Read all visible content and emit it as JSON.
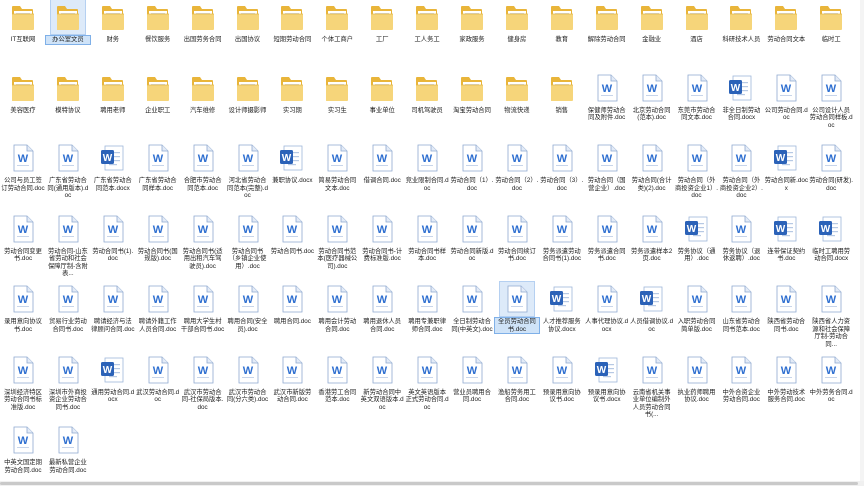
{
  "items": [
    {
      "label": "IT互联网",
      "icon": "folder-icon"
    },
    {
      "label": "办公室文员",
      "icon": "folder-icon",
      "selected": true
    },
    {
      "label": "财务",
      "icon": "folder-icon"
    },
    {
      "label": "餐饮服务",
      "icon": "folder-icon"
    },
    {
      "label": "出国劳务合同",
      "icon": "folder-icon"
    },
    {
      "label": "出国协议",
      "icon": "folder-icon"
    },
    {
      "label": "短期劳动合同",
      "icon": "folder-icon"
    },
    {
      "label": "个体工商户",
      "icon": "folder-icon"
    },
    {
      "label": "工厂",
      "icon": "folder-icon"
    },
    {
      "label": "工人务工",
      "icon": "folder-icon"
    },
    {
      "label": "家政服务",
      "icon": "folder-icon"
    },
    {
      "label": "健身房",
      "icon": "folder-icon"
    },
    {
      "label": "教育",
      "icon": "folder-icon"
    },
    {
      "label": "解除劳动合同",
      "icon": "folder-icon"
    },
    {
      "label": "金融业",
      "icon": "folder-icon"
    },
    {
      "label": "酒店",
      "icon": "folder-icon"
    },
    {
      "label": "科研技术人员",
      "icon": "folder-icon"
    },
    {
      "label": "劳动合同文本",
      "icon": "folder-icon"
    },
    {
      "label": "临时工",
      "icon": "folder-icon"
    },
    {
      "label": "美容医疗",
      "icon": "folder-icon"
    },
    {
      "label": "模特协议",
      "icon": "folder-icon"
    },
    {
      "label": "聘用老师",
      "icon": "folder-icon"
    },
    {
      "label": "企业职工",
      "icon": "folder-icon"
    },
    {
      "label": "汽车维修",
      "icon": "folder-icon"
    },
    {
      "label": "设计师摄影师",
      "icon": "folder-icon"
    },
    {
      "label": "实习期",
      "icon": "folder-icon"
    },
    {
      "label": "实习生",
      "icon": "folder-icon"
    },
    {
      "label": "事业单位",
      "icon": "folder-icon"
    },
    {
      "label": "司机驾驶员",
      "icon": "folder-icon"
    },
    {
      "label": "淘宝劳动合同",
      "icon": "folder-icon"
    },
    {
      "label": "物流快递",
      "icon": "folder-icon"
    },
    {
      "label": "销售",
      "icon": "folder-icon"
    },
    {
      "label": "保健师劳动合同及附件.doc",
      "icon": "word-doc-icon"
    },
    {
      "label": "北京劳动合同(范本).doc",
      "icon": "word-doc-icon"
    },
    {
      "label": "东莞市劳动合同文本.doc",
      "icon": "word-doc-icon"
    },
    {
      "label": "非全日制劳动合同.docx",
      "icon": "word-docx-icon"
    },
    {
      "label": "公司劳动合同.doc",
      "icon": "word-doc-icon"
    },
    {
      "label": "公司设计人员劳动合同样板.doc",
      "icon": "word-doc-icon"
    },
    {
      "label": "公司与员工签订劳动合同.doc",
      "icon": "word-doc-icon"
    },
    {
      "label": "广东省劳动合同(通用版本).doc",
      "icon": "word-doc-icon"
    },
    {
      "label": "广东省劳动合同范本.docx",
      "icon": "word-docx-icon"
    },
    {
      "label": "广东省劳动合同样本.doc",
      "icon": "word-doc-icon"
    },
    {
      "label": "合肥市劳动合同范本.doc",
      "icon": "word-doc-icon"
    },
    {
      "label": "河北省劳动合同范本(完整).doc",
      "icon": "word-doc-icon"
    },
    {
      "label": "兼职协议.docx",
      "icon": "word-docx-icon"
    },
    {
      "label": "简易劳动合同文本.doc",
      "icon": "word-doc-icon"
    },
    {
      "label": "借调合同.doc",
      "icon": "word-doc-icon"
    },
    {
      "label": "竞业限制合同.doc",
      "icon": "word-doc-icon"
    },
    {
      "label": "劳动合同（1）.doc",
      "icon": "word-doc-icon"
    },
    {
      "label": "劳动合同（2）.doc",
      "icon": "word-doc-icon"
    },
    {
      "label": "劳动合同（3）.doc",
      "icon": "word-doc-icon"
    },
    {
      "label": "劳动合同（国营企业）.doc",
      "icon": "word-doc-icon"
    },
    {
      "label": "劳动合同(合计类)(2).doc",
      "icon": "word-doc-icon"
    },
    {
      "label": "劳动合同（外商投资企业1）.doc",
      "icon": "word-doc-icon"
    },
    {
      "label": "劳动合同（外商投资企业2）.doc",
      "icon": "word-doc-icon"
    },
    {
      "label": "劳动合同新.docx",
      "icon": "word-docx-icon"
    },
    {
      "label": "劳动合同(研发).doc",
      "icon": "word-doc-icon"
    },
    {
      "label": "劳动合同变更书.doc",
      "icon": "word-doc-icon"
    },
    {
      "label": "劳动合同-山东省劳动和社会保障厅制-含附表...",
      "icon": "word-doc-icon"
    },
    {
      "label": "劳动合同书(1).doc",
      "icon": "word-doc-icon"
    },
    {
      "label": "劳动合同书(国规版).doc",
      "icon": "word-doc-icon"
    },
    {
      "label": "劳动合同书(适用出租汽车驾驶员).doc",
      "icon": "word-doc-icon"
    },
    {
      "label": "劳动合同书（乡镇企业使用）.doc",
      "icon": "word-doc-icon"
    },
    {
      "label": "劳动合同书.doc",
      "icon": "word-doc-icon"
    },
    {
      "label": "劳动合同书范本(医疗器械公司).doc",
      "icon": "word-doc-icon"
    },
    {
      "label": "劳动合同书-计费标准版.doc",
      "icon": "word-doc-icon"
    },
    {
      "label": "劳动合同书样本.doc",
      "icon": "word-doc-icon"
    },
    {
      "label": "劳动合同新版.doc",
      "icon": "word-doc-icon"
    },
    {
      "label": "劳动合同续订书.doc",
      "icon": "word-doc-icon"
    },
    {
      "label": "劳务派遣劳动合同书(1).doc",
      "icon": "word-doc-icon"
    },
    {
      "label": "劳务派遣合同书.doc",
      "icon": "word-doc-icon"
    },
    {
      "label": "劳务派遣样本2页.doc",
      "icon": "word-doc-icon"
    },
    {
      "label": "劳务协议（通用）.doc",
      "icon": "word-docx-icon"
    },
    {
      "label": "劳务协议（退休返聘）.doc",
      "icon": "word-doc-icon"
    },
    {
      "label": "连带保证契约书.doc",
      "icon": "word-docx-icon"
    },
    {
      "label": "临时工聘用劳动合同.docx",
      "icon": "word-docx-icon"
    },
    {
      "label": "录用意向协议书.doc",
      "icon": "word-doc-icon"
    },
    {
      "label": "贸易行业劳动合同书.doc",
      "icon": "word-doc-icon"
    },
    {
      "label": "聘请经济与法律顾问合同.doc",
      "icon": "word-doc-icon"
    },
    {
      "label": "聘请外籍工作人员合同.doc",
      "icon": "word-doc-icon"
    },
    {
      "label": "聘用大学生村干部合同书.doc",
      "icon": "word-doc-icon"
    },
    {
      "label": "聘用合同(安全员).doc",
      "icon": "word-doc-icon"
    },
    {
      "label": "聘用合同.doc",
      "icon": "word-doc-icon"
    },
    {
      "label": "聘用会计劳动合同.doc",
      "icon": "word-doc-icon"
    },
    {
      "label": "聘用退休人员合同.doc",
      "icon": "word-doc-icon"
    },
    {
      "label": "聘用专兼职律师合同.doc",
      "icon": "word-doc-icon"
    },
    {
      "label": "全日制劳动合同(中英文).doc",
      "icon": "word-doc-icon"
    },
    {
      "label": "全员劳动合同书.doc",
      "icon": "word-doc-icon",
      "selected": true
    },
    {
      "label": "人才推荐服务协议.docx",
      "icon": "word-docx-icon"
    },
    {
      "label": "人事代理协议.docx",
      "icon": "word-doc-icon"
    },
    {
      "label": "人员借调协议.doc",
      "icon": "word-docx-icon"
    },
    {
      "label": "入职劳动合同简单版.doc",
      "icon": "word-doc-icon"
    },
    {
      "label": "山东省劳动合同书范本.doc",
      "icon": "word-doc-icon"
    },
    {
      "label": "陕西省劳动合同书.doc",
      "icon": "word-doc-icon"
    },
    {
      "label": "陕西省人力资源和社会保障厅制-劳动合同...",
      "icon": "word-doc-icon"
    },
    {
      "label": "深圳经济特区劳动合同书标准版.doc",
      "icon": "word-doc-icon"
    },
    {
      "label": "深圳市外商投资企业劳动合同书.doc",
      "icon": "word-doc-icon"
    },
    {
      "label": "通用劳动合同.docx",
      "icon": "word-docx-icon"
    },
    {
      "label": "武汉劳动合同.doc",
      "icon": "word-doc-icon"
    },
    {
      "label": "武汉市劳动合同-社保局版本.doc",
      "icon": "word-doc-icon"
    },
    {
      "label": "武汉市劳动合同(分六类).doc",
      "icon": "word-doc-icon"
    },
    {
      "label": "武汉市新版劳动合同.doc",
      "icon": "word-doc-icon"
    },
    {
      "label": "香港劳工合同范本.doc",
      "icon": "word-doc-icon"
    },
    {
      "label": "新劳动合同中英文双语版本.doc",
      "icon": "word-doc-icon"
    },
    {
      "label": "英文英语版本正式劳动合同.doc",
      "icon": "word-doc-icon"
    },
    {
      "label": "营业员聘用合同.doc",
      "icon": "word-doc-icon"
    },
    {
      "label": "渔船劳务用工合同.doc",
      "icon": "word-doc-icon"
    },
    {
      "label": "预录用意向协议书.doc",
      "icon": "word-doc-icon"
    },
    {
      "label": "预录用意向协议书.docx",
      "icon": "word-docx-icon"
    },
    {
      "label": "云南省机关事业单位编制外人员劳动合同书(...",
      "icon": "word-doc-icon"
    },
    {
      "label": "执业药师聘用协议.doc",
      "icon": "word-doc-icon"
    },
    {
      "label": "中外合资企业劳动合同.doc",
      "icon": "word-doc-icon"
    },
    {
      "label": "中外劳动技术服务合同.doc",
      "icon": "word-doc-icon"
    },
    {
      "label": "中外劳务合同.doc",
      "icon": "word-doc-icon"
    },
    {
      "label": "中英文国定期劳动合同.doc",
      "icon": "word-doc-icon"
    },
    {
      "label": "最新私营企业劳动合同.doc",
      "icon": "word-doc-icon"
    }
  ]
}
